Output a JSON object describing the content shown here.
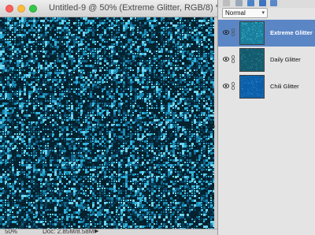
{
  "document": {
    "title": "Untitled-9 @ 50% (Extreme Glitter, RGB/8) *",
    "zoom": "50%",
    "doc_size": "Doc: 2.85M/8.58M"
  },
  "colors": {
    "glitter_dark": "#05222f",
    "glitter_palette": [
      "#04202c",
      "#0b3c55",
      "#116285",
      "#1a8ab4",
      "#32b3dc",
      "#6fd4ee"
    ],
    "selection": "#5b86c5"
  },
  "layers_panel": {
    "blend_mode": "Normal",
    "toolbar_icons": [
      "new-layer-icon",
      "adjustment-layer-icon",
      "trash-icon",
      "lock-icon",
      "link-layers-icon"
    ],
    "layers": [
      {
        "name": "Extreme Glitter",
        "selected": true,
        "visible": true,
        "thumb_color": "#1a7e9c",
        "thumb_speckle": "#3fc2e0"
      },
      {
        "name": "Daily Glitter",
        "selected": false,
        "visible": true,
        "thumb_color": "#135a6d",
        "thumb_speckle": "#2d8aa3"
      },
      {
        "name": "Chili Glitter",
        "selected": false,
        "visible": true,
        "thumb_color": "#0b5fa8",
        "thumb_speckle": "#2a86d0"
      }
    ]
  }
}
